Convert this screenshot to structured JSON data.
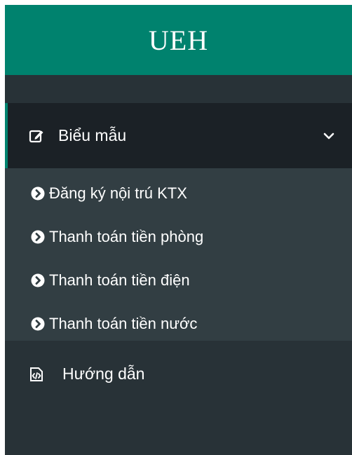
{
  "brand": {
    "title": "UEH",
    "color": "#00826e"
  },
  "menu": {
    "forms": {
      "label": "Biểu mẫu",
      "icon": "edit-icon",
      "expanded": true,
      "items": [
        {
          "label": "Đăng ký nội trú KTX",
          "icon": "chevron-circle-right-icon"
        },
        {
          "label": "Thanh toán tiền phòng",
          "icon": "chevron-circle-right-icon"
        },
        {
          "label": "Thanh toán tiền điện",
          "icon": "chevron-circle-right-icon"
        },
        {
          "label": "Thanh toán tiền nước",
          "icon": "chevron-circle-right-icon"
        }
      ]
    },
    "guide": {
      "label": "Hướng dẫn",
      "icon": "code-file-icon"
    }
  },
  "colors": {
    "sidebar_bg": "#283237",
    "active_bg": "#1b2126",
    "submenu_bg": "#323e43",
    "accent": "#00826e"
  }
}
